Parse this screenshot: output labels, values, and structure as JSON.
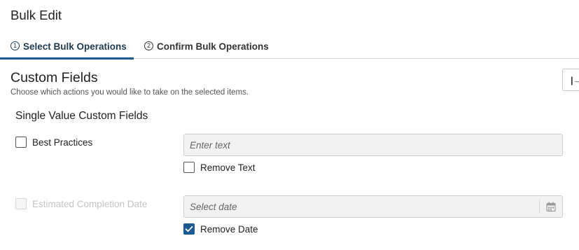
{
  "page": {
    "title": "Bulk Edit"
  },
  "tabs": [
    {
      "step": "1",
      "label": "Select Bulk Operations",
      "active": true
    },
    {
      "step": "2",
      "label": "Confirm Bulk Operations",
      "active": false
    }
  ],
  "section": {
    "title": "Custom Fields",
    "subtitle": "Choose which actions you would like to take on the selected items.",
    "collapse_label": "|→"
  },
  "group": {
    "title": "Single Value Custom Fields"
  },
  "fields": [
    {
      "label": "Best Practices",
      "enabled": false,
      "disabled": false,
      "input_placeholder": "Enter text",
      "remove_label": "Remove Text",
      "remove_checked": false
    },
    {
      "label": "Estimated Completion Date",
      "enabled": false,
      "disabled": true,
      "input_placeholder": "Select date",
      "remove_label": "Remove Date",
      "remove_checked": true
    }
  ],
  "colors": {
    "accent": "#1b5a93",
    "input_bg": "#f2f2f2",
    "disabled_text": "#c4c4c4"
  },
  "icons": {
    "calendar": "calendar-icon",
    "check": "checkmark-icon"
  }
}
